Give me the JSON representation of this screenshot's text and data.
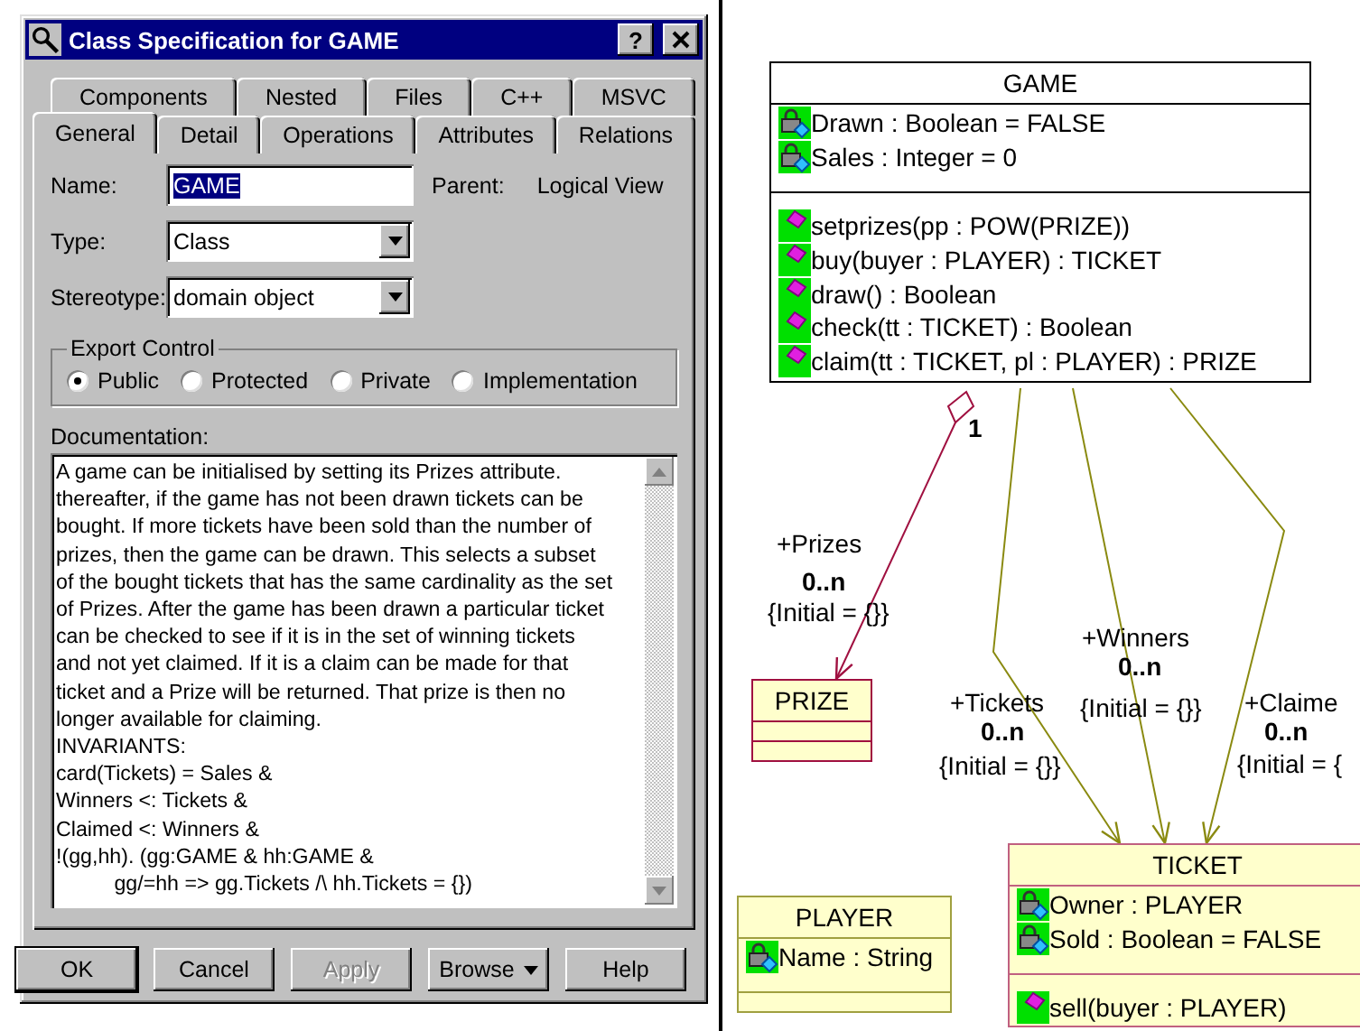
{
  "dialog": {
    "title": "Class Specification for GAME",
    "help_button": "?",
    "tab_rows": [
      [
        {
          "label": "Components",
          "selected": false
        },
        {
          "label": "Nested",
          "selected": false
        },
        {
          "label": "Files",
          "selected": false
        },
        {
          "label": "C++",
          "selected": false
        },
        {
          "label": "MSVC",
          "selected": false
        }
      ],
      [
        {
          "label": "General",
          "selected": true
        },
        {
          "label": "Detail",
          "selected": false
        },
        {
          "label": "Operations",
          "selected": false
        },
        {
          "label": "Attributes",
          "selected": false
        },
        {
          "label": "Relations",
          "selected": false
        }
      ]
    ],
    "name": {
      "label": "Name:",
      "value": "GAME"
    },
    "parent": {
      "label": "Parent:",
      "value": "Logical View"
    },
    "type": {
      "label": "Type:",
      "value": "Class"
    },
    "stereotype": {
      "label": "Stereotype:",
      "value": "domain object"
    },
    "export_control": {
      "label": "Export Control",
      "options": [
        {
          "label": "Public",
          "selected": true
        },
        {
          "label": "Protected",
          "selected": false
        },
        {
          "label": "Private",
          "selected": false
        },
        {
          "label": "Implementation",
          "selected": false
        }
      ]
    },
    "documentation": {
      "label": "Documentation:",
      "lines": [
        "A game can be initialised by setting its Prizes attribute.",
        "thereafter, if the game has not been drawn tickets can be",
        "bought. If more tickets have been sold than the number of",
        "prizes, then the game can be drawn. This selects a subset",
        "of the bought tickets that has the same cardinality as the set",
        "of Prizes. After the game has been drawn a particular ticket",
        "can be checked to see if it is in the set of winning tickets",
        "and not yet claimed. If it is a claim can be made for that",
        "ticket and a Prize will be returned. That prize is then no",
        "longer available for claiming.",
        "INVARIANTS:",
        "card(Tickets) = Sales &",
        "Winners <: Tickets &",
        "Claimed <: Winners &",
        "!(gg,hh). (gg:GAME & hh:GAME &",
        "          gg/=hh => gg.Tickets /\\ hh.Tickets = {})"
      ]
    },
    "buttons": [
      {
        "label": "OK",
        "disabled": false,
        "kind": "plain"
      },
      {
        "label": "Cancel",
        "disabled": false,
        "kind": "plain"
      },
      {
        "label": "Apply",
        "disabled": true,
        "kind": "plain"
      },
      {
        "label": "Browse",
        "disabled": false,
        "kind": "menu"
      },
      {
        "label": "Help",
        "disabled": false,
        "kind": "plain"
      }
    ]
  },
  "diagram": {
    "classes": [
      {
        "name": "GAME",
        "color": "#000000",
        "attributes": [
          "Drawn : Boolean = FALSE",
          "Sales : Integer = 0"
        ],
        "operations": [
          "setprizes(pp : POW(PRIZE))",
          "buy(buyer : PLAYER) : TICKET",
          "draw() : Boolean",
          "check(tt : TICKET) : Boolean",
          "claim(tt : TICKET, pl : PLAYER) : PRIZE"
        ]
      },
      {
        "name": "PRIZE",
        "color": "#a01040"
      },
      {
        "name": "PLAYER",
        "color": "#a0a040",
        "attributes": [
          "Name : String"
        ]
      },
      {
        "name": "TICKET",
        "color": "#c06080",
        "attributes": [
          "Owner : PLAYER",
          "Sold : Boolean = FALSE"
        ],
        "operations": [
          "sell(buyer : PLAYER)"
        ]
      }
    ],
    "associations": [
      {
        "kind": "aggregation",
        "color": "#a01040",
        "source_multiplicity": "1",
        "role": "+Prizes",
        "multiplicity": "0..n",
        "constraint": "{Initial = {}}"
      },
      {
        "kind": "association",
        "color": "#8a8a10",
        "role": "+Tickets",
        "multiplicity": "0..n",
        "constraint": "{Initial = {}}"
      },
      {
        "kind": "association",
        "color": "#8a8a10",
        "role": "+Winners",
        "multiplicity": "0..n",
        "constraint": "{Initial = {}}"
      },
      {
        "kind": "association",
        "color": "#8a8a10",
        "role": "+Claime",
        "multiplicity": "0..n",
        "constraint": "{Initial = {"
      }
    ]
  }
}
